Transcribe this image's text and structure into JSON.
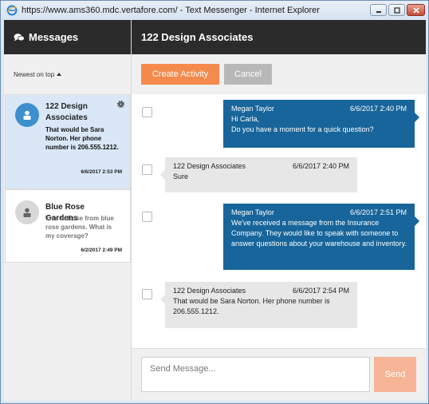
{
  "window": {
    "title": "https://www.ams360.mdc.vertafore.com/ - Text Messenger - Internet Explorer"
  },
  "sidebar": {
    "title": "Messages",
    "sort_label": "Newest on top",
    "conversations": [
      {
        "name": "122 Design Associates",
        "preview": "That would be Sara Norton. Her phone number is 206.555.1212.",
        "time": "6/6/2017 2:53 PM"
      },
      {
        "name": "Blue Rose Gardens",
        "preview": "This is Rose from blue rose gardens. What is my coverage?",
        "time": "6/2/2017 2:49 PM"
      }
    ]
  },
  "main": {
    "title": "122 Design Associates",
    "create_label": "Create Activity",
    "cancel_label": "Cancel"
  },
  "messages": [
    {
      "sender": "Megan Taylor",
      "time": "6/6/2017 2:40 PM",
      "text": "Hi Carla,\nDo you have a moment for a quick question?",
      "direction": "out"
    },
    {
      "sender": "122 Design Associates",
      "time": "6/6/2017 2:40 PM",
      "text": "Sure",
      "direction": "in"
    },
    {
      "sender": "Megan Taylor",
      "time": "6/6/2017 2:51 PM",
      "text": "We've received a message from the Insurance Company. They would like to speak with someone to answer questions about your warehouse and inventory.",
      "direction": "out"
    },
    {
      "sender": "122 Design Associates",
      "time": "6/6/2017 2:54 PM",
      "text": "That would be Sara Norton. Her phone number is 206.555.1212.",
      "direction": "in"
    }
  ],
  "compose": {
    "placeholder": "Send Message...",
    "send_label": "Send"
  },
  "colors": {
    "accent": "#f58a4d",
    "outgoing": "#17659a",
    "header": "#2b2b2b",
    "active_conversation": "#d9e7f7"
  }
}
